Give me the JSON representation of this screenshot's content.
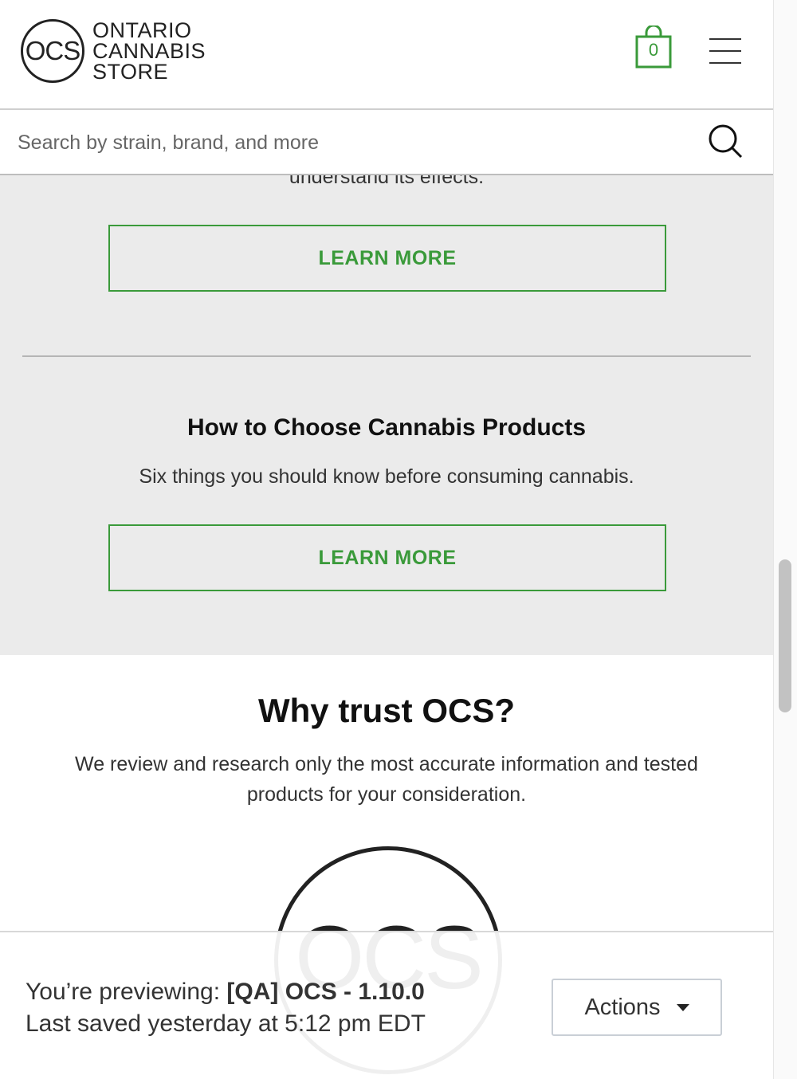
{
  "header": {
    "logo": {
      "mark": "OCS",
      "line1": "ONTARIO",
      "line2": "CANNABIS",
      "line3": "STORE"
    },
    "cart_count": "0",
    "icons": {
      "cart": "shopping-bag-icon",
      "menu": "hamburger-menu-icon"
    }
  },
  "search": {
    "placeholder": "Search by strain, brand, and more",
    "icon": "search-icon"
  },
  "content": {
    "clipped_text": "understand its effects.",
    "learn_more_1": "LEARN MORE",
    "card_title": "How to Choose Cannabis Products",
    "card_desc": "Six things you should know before consuming cannabis.",
    "learn_more_2": "LEARN MORE"
  },
  "trust": {
    "title": "Why trust OCS?",
    "desc": "We review and research only the most accurate information and tested products for your consideration.",
    "logo_mark": "OCS"
  },
  "preview_bar": {
    "previewing_label": "You’re previewing:",
    "version": "[QA] OCS - 1.10.0",
    "last_saved": "Last saved yesterday at 5:12 pm EDT",
    "actions_label": "Actions"
  },
  "colors": {
    "accent_green": "#3a9a3a",
    "grey_bg": "#ebebeb"
  }
}
